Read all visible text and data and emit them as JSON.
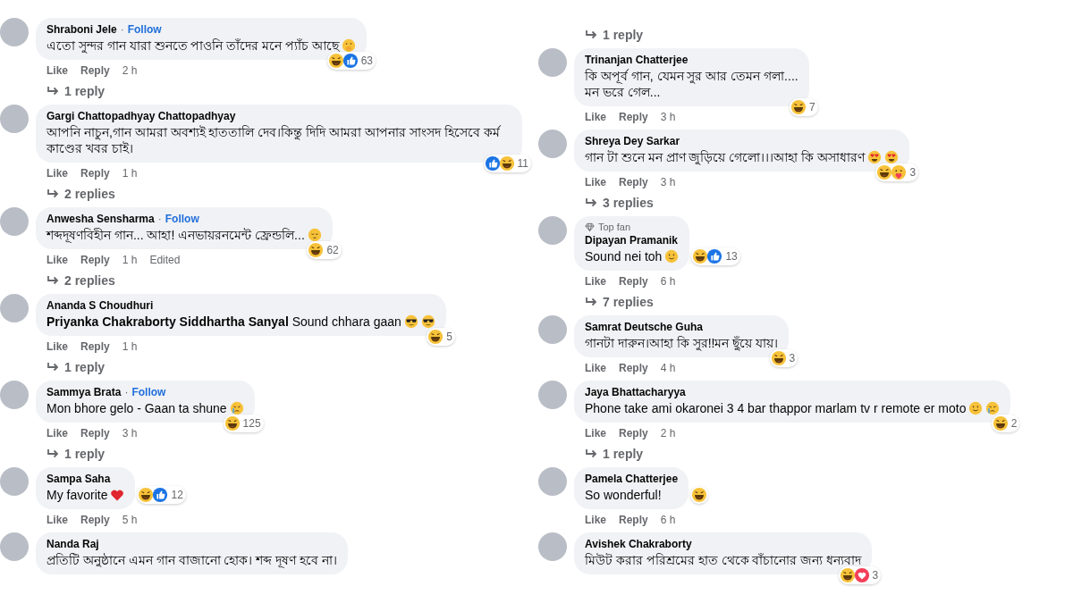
{
  "columns": [
    {
      "items": [
        {
          "kind": "comment",
          "author": "Shraboni Jele",
          "follow": {
            "separator": "·",
            "label": "Follow"
          },
          "text": "এতো সুন্দর গান যারা শুনতে পাওনি তাঁদের মনে প্যাঁচ আছে",
          "emojis": [
            {
              "kind": "hand-over-mouth"
            }
          ],
          "reactions": {
            "icons": [
              {
                "kind": "haha"
              },
              {
                "kind": "like"
              }
            ],
            "count": "63"
          },
          "actions": {
            "like": "Like",
            "reply": "Reply",
            "time": "2 h"
          },
          "replies": "1 reply"
        },
        {
          "kind": "comment",
          "author": "Gargi Chattopadhyay Chattopadhyay",
          "text": "আপনি নাচুন,গান আমরা অবশ্যই হাততালি দেব।কিন্তু দিদি আমরা আপনার সাংসদ হিসেবে কর্ম কাণ্ডের খবর চাই।",
          "reactions": {
            "icons": [
              {
                "kind": "like"
              },
              {
                "kind": "haha"
              }
            ],
            "count": "11"
          },
          "actions": {
            "like": "Like",
            "reply": "Reply",
            "time": "1 h"
          },
          "replies": "2 replies"
        },
        {
          "kind": "comment",
          "author": "Anwesha Sensharma",
          "follow": {
            "separator": "·",
            "label": "Follow"
          },
          "text": "শব্দদূষণবিহীন গান... আহা! এনভায়রনমেন্ট ফ্রেন্ডলি...",
          "emojis": [
            {
              "kind": "pensive"
            }
          ],
          "reactions": {
            "icons": [
              {
                "kind": "haha"
              }
            ],
            "count": "62"
          },
          "actions": {
            "like": "Like",
            "reply": "Reply",
            "time": "1 h",
            "edited": "Edited"
          },
          "replies": "2 replies"
        },
        {
          "kind": "comment",
          "author": "Ananda S Choudhuri",
          "text": "**Priyanka Chakraborty Siddhartha Sanyal** Sound chhara gaan",
          "emojis": [
            {
              "kind": "sunglasses"
            },
            {
              "kind": "sunglasses"
            }
          ],
          "reactions": {
            "icons": [
              {
                "kind": "haha"
              }
            ],
            "count": "5"
          },
          "actions": {
            "like": "Like",
            "reply": "Reply",
            "time": "1 h"
          },
          "replies": "1 reply"
        },
        {
          "kind": "comment",
          "author": "Sammya Brata",
          "follow": {
            "separator": "·",
            "label": "Follow"
          },
          "text": "Mon bhore gelo - Gaan ta shune",
          "emojis": [
            {
              "kind": "crying"
            }
          ],
          "reactions": {
            "icons": [
              {
                "kind": "haha"
              }
            ],
            "count": "125"
          },
          "actions": {
            "like": "Like",
            "reply": "Reply",
            "time": "3 h"
          },
          "replies": "1 reply"
        },
        {
          "kind": "comment",
          "author": "Sampa Saha",
          "text": "My favorite",
          "emojis": [
            {
              "kind": "heart"
            }
          ],
          "reactions": {
            "icons": [
              {
                "kind": "haha"
              },
              {
                "kind": "like"
              }
            ],
            "count": "12"
          },
          "actions": {
            "like": "Like",
            "reply": "Reply",
            "time": "5 h"
          }
        },
        {
          "kind": "comment",
          "author": "Nanda Raj",
          "text": "প্রতিটি অনুষ্ঠানে এমন গান বাজানো হোক। শব্দ দূষণ হবে না।"
        }
      ]
    },
    {
      "items": [
        {
          "kind": "replies-link",
          "replies": "1 reply"
        },
        {
          "kind": "comment",
          "author": "Trinanjan Chatterjee",
          "text": "কি অপূর্ব গান, যেমন সুর আর তেমন গলা....\nমন ভরে গেল...",
          "reactions": {
            "icons": [
              {
                "kind": "haha"
              }
            ],
            "count": "7"
          },
          "actions": {
            "like": "Like",
            "reply": "Reply",
            "time": "3 h"
          }
        },
        {
          "kind": "comment",
          "author": "Shreya Dey Sarkar",
          "text": "গান টা শুনে মন প্রাণ জুড়িয়ে গেলো।।।আহা কি অসাধারণ",
          "emojis": [
            {
              "kind": "heart-eyes"
            },
            {
              "kind": "heart-eyes"
            }
          ],
          "reactions": {
            "icons": [
              {
                "kind": "haha"
              },
              {
                "kind": "care"
              }
            ],
            "count": "3"
          },
          "actions": {
            "like": "Like",
            "reply": "Reply",
            "time": "3 h"
          },
          "replies": "3 replies"
        },
        {
          "kind": "comment",
          "badge": "Top fan",
          "author": "Dipayan Pramanik",
          "text": "Sound nei toh",
          "emojis": [
            {
              "kind": "smile"
            }
          ],
          "reactions": {
            "icons": [
              {
                "kind": "haha"
              },
              {
                "kind": "like"
              }
            ],
            "count": "13"
          },
          "actions": {
            "like": "Like",
            "reply": "Reply",
            "time": "6 h"
          },
          "replies": "7 replies"
        },
        {
          "kind": "comment",
          "author": "Samrat Deutsche Guha",
          "text": "গানটা দারুন।আহা কি সুর!!মন ছুঁয়ে যায়।",
          "reactions": {
            "icons": [
              {
                "kind": "haha"
              }
            ],
            "count": "3"
          },
          "actions": {
            "like": "Like",
            "reply": "Reply",
            "time": "4 h"
          }
        },
        {
          "kind": "comment",
          "author": "Jaya Bhattacharyya",
          "text": "Phone take ami okaronei 3 4 bar thappor marlam tv r remote er moto",
          "emojis": [
            {
              "kind": "smile"
            },
            {
              "kind": "crying"
            }
          ],
          "reactions": {
            "icons": [
              {
                "kind": "haha"
              }
            ],
            "count": "2"
          },
          "actions": {
            "like": "Like",
            "reply": "Reply",
            "time": "2 h"
          },
          "replies": "1 reply"
        },
        {
          "kind": "comment",
          "author": "Pamela Chatterjee",
          "text": "So wonderful!",
          "reactions": {
            "icons": [
              {
                "kind": "haha"
              }
            ]
          },
          "actions": {
            "like": "Like",
            "reply": "Reply",
            "time": "6 h"
          }
        },
        {
          "kind": "comment",
          "author": "Avishek Chakraborty",
          "text": "মিউট করার পরিশ্রমের হাত থেকে বাঁচানোর জন্য ধন্যবাদ",
          "reactions": {
            "icons": [
              {
                "kind": "haha"
              },
              {
                "kind": "love"
              }
            ],
            "count": "3"
          }
        }
      ]
    }
  ]
}
